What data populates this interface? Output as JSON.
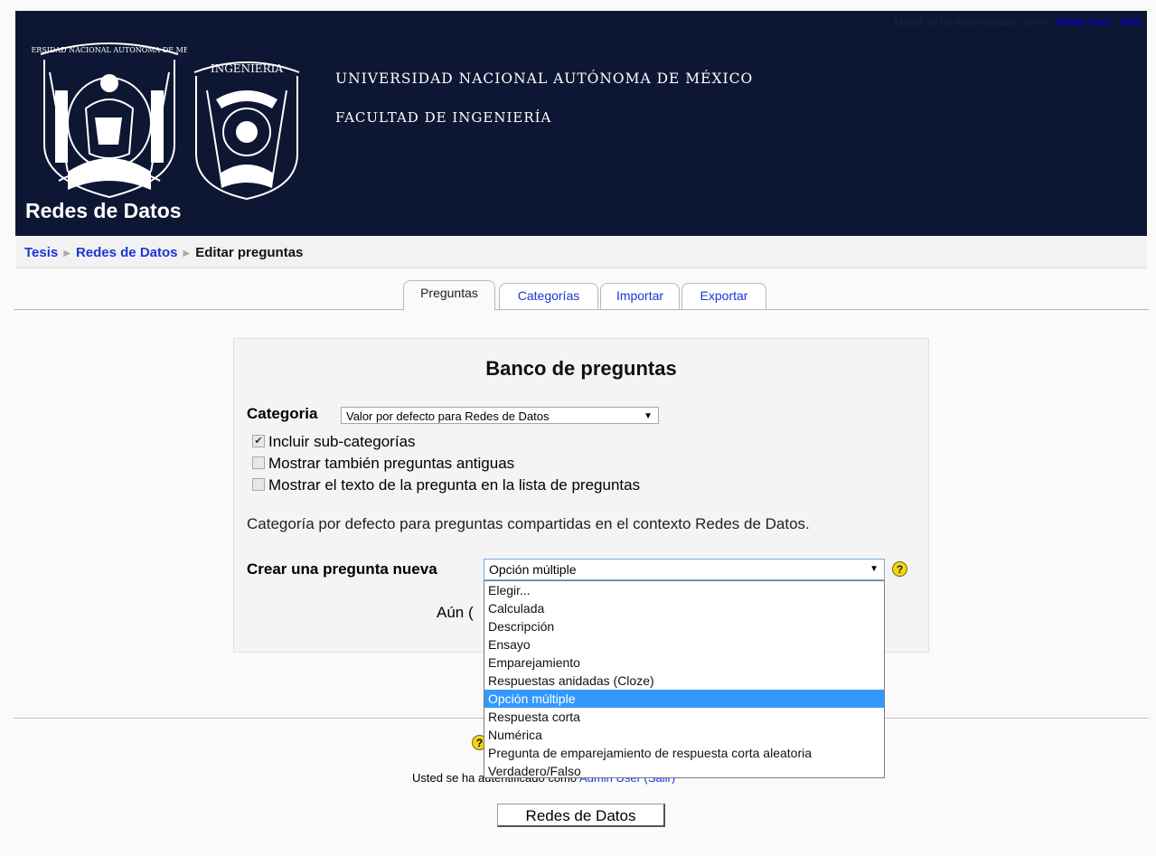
{
  "header": {
    "university": "UNIVERSIDAD NACIONAL AUTÓNOMA DE MÉXICO",
    "faculty": "FACULTAD DE INGENIERÍA",
    "site_name": "Redes de Datos",
    "logo_unam_text": "UNIVERSIDAD NACIONAL AUTONOMA DE MEXICO",
    "logo_fi_text": "INGENIERIA",
    "login_prefix": "Usted se ha autentificado como",
    "login_user": "Admin User",
    "login_exit": "Salir"
  },
  "breadcrumb": {
    "items": [
      "Tesis",
      "Redes de Datos"
    ],
    "current": "Editar preguntas"
  },
  "tabs": [
    "Preguntas",
    "Categorías",
    "Importar",
    "Exportar"
  ],
  "panel": {
    "title": "Banco de preguntas",
    "category_label": "Categoria",
    "category_value": "Valor por defecto para Redes de Datos",
    "checkboxes": [
      {
        "label": "Incluir sub-categorías",
        "checked": true
      },
      {
        "label": "Mostrar también preguntas antiguas",
        "checked": false
      },
      {
        "label": "Mostrar el texto de la pregunta en la lista de preguntas",
        "checked": false
      }
    ],
    "info_text": "Categoría por defecto para preguntas compartidas en el contexto Redes de Datos.",
    "new_question_label": "Crear una pregunta nueva",
    "new_question_value": "Opción múltiple",
    "aun_text": "Aún ("
  },
  "dropdown": {
    "options": [
      "Elegir...",
      "Calculada",
      "Descripción",
      "Ensayo",
      "Emparejamiento",
      "Respuestas anidadas (Cloze)",
      "Opción múltiple",
      "Respuesta corta",
      "Numérica",
      "Pregunta de emparejamiento de respuesta corta aleatoria",
      "Verdadero/Falso"
    ],
    "selected_index": 6
  },
  "footer": {
    "logged_prefix": "Usted se ha autentificado como",
    "logged_user": "Admin User (Salir)",
    "button": "Redes de Datos"
  },
  "icons": {
    "help": "question-mark-help-icon",
    "breadcrumb_separator": "triangle-right-icon",
    "select_arrow": "triangle-down-icon"
  },
  "colors": {
    "header_bg": "#0d1733",
    "link": "#1f35d6",
    "selection": "#3399ff",
    "help_icon": "#f3d31a"
  }
}
